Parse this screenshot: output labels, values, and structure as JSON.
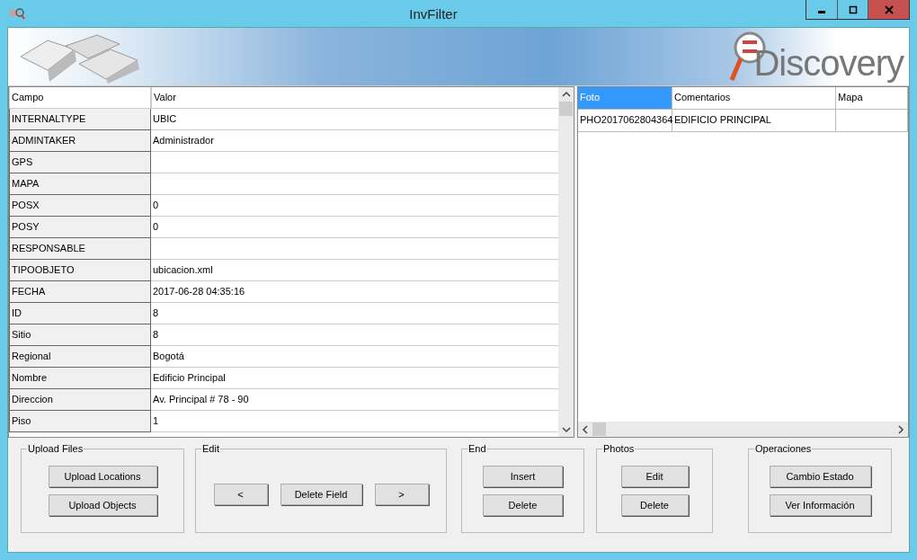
{
  "window": {
    "title": "InvFilter"
  },
  "banner": {
    "logo_text": "Discovery"
  },
  "properties": {
    "columns": [
      "Campo",
      "Valor"
    ],
    "rows": [
      {
        "field": "INTERNALTYPE",
        "value": "UBIC"
      },
      {
        "field": "ADMINTAKER",
        "value": "Administrador"
      },
      {
        "field": "GPS",
        "value": ""
      },
      {
        "field": "MAPA",
        "value": ""
      },
      {
        "field": "POSX",
        "value": "0"
      },
      {
        "field": "POSY",
        "value": "0"
      },
      {
        "field": "RESPONSABLE",
        "value": ""
      },
      {
        "field": "TIPOOBJETO",
        "value": "ubicacion.xml"
      },
      {
        "field": "FECHA",
        "value": "2017-06-28 04:35:16"
      },
      {
        "field": "ID",
        "value": "8"
      },
      {
        "field": "Sitio",
        "value": "8"
      },
      {
        "field": "Regional",
        "value": "Bogotá"
      },
      {
        "field": "Nombre",
        "value": "Edificio Principal"
      },
      {
        "field": "Direccion",
        "value": "Av. Principal # 78 - 90"
      },
      {
        "field": "Piso",
        "value": "1"
      }
    ]
  },
  "photos": {
    "columns": [
      {
        "label": "Foto",
        "selected": true
      },
      {
        "label": "Comentarios",
        "selected": false
      },
      {
        "label": "Mapa",
        "selected": false
      }
    ],
    "rows": [
      [
        "PHO2017062804364",
        "EDIFICIO PRINCIPAL",
        ""
      ]
    ]
  },
  "groups": [
    {
      "title": "Upload Files",
      "buttons": [
        "Upload Locations",
        "Upload Objects"
      ]
    },
    {
      "title": "Edit",
      "buttons": [
        "<",
        "Delete Field",
        ">"
      ]
    },
    {
      "title": "End",
      "buttons": [
        "Insert",
        "Delete"
      ]
    },
    {
      "title": "Photos",
      "buttons": [
        "Edit",
        "Delete"
      ]
    },
    {
      "title": "Operaciones",
      "buttons": [
        "Cambio Estado",
        "Ver Información"
      ]
    }
  ]
}
